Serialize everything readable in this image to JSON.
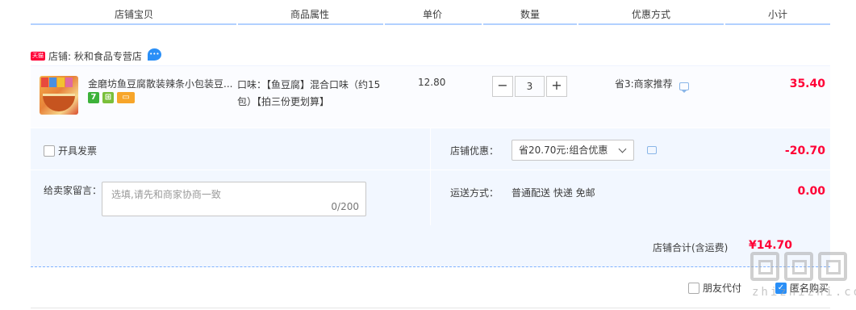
{
  "header": {
    "col_shop_item": "店铺宝贝",
    "col_attr": "商品属性",
    "col_price": "单价",
    "col_qty": "数量",
    "col_discount": "优惠方式",
    "col_subtotal": "小计"
  },
  "shop": {
    "badge": "天猫",
    "label": "店铺: 秋和食品专营店"
  },
  "item": {
    "title": "金磨坊鱼豆腐散装辣条小包装豆...",
    "attr": "口味：【鱼豆腐】混合口味（约15包）【拍三份更划算】",
    "price": "12.80",
    "qty_minus": "−",
    "qty_value": "3",
    "qty_plus": "+",
    "discount": "省3:商家推荐",
    "subtotal": "35.40",
    "svc_seven": "7"
  },
  "options": {
    "invoice_label": "开具发票",
    "memo_label": "给卖家留言：",
    "memo_placeholder": "选填,请先和商家协商一致",
    "memo_count": "0/200",
    "shop_discount_label": "店铺优惠：",
    "shop_discount_value": "省20.70元:组合优惠",
    "shop_discount_amount": "-20.70",
    "shipping_label": "运送方式：",
    "shipping_value": "普通配送 快递 免邮",
    "shipping_amount": "0.00"
  },
  "total": {
    "label": "店铺合计(含运费)",
    "amount": "¥14.70"
  },
  "footer": {
    "friend_pay": "朋友代付",
    "anonymous_buy": "匿名购买"
  },
  "watermark": {
    "text": "zhizhizhi.com"
  },
  "colors": {
    "accent_red": "#ff0036",
    "header_line": "#b2d1ff",
    "panel_bg": "#f2f7ff",
    "checkbox_blue": "#2a8ff7"
  }
}
